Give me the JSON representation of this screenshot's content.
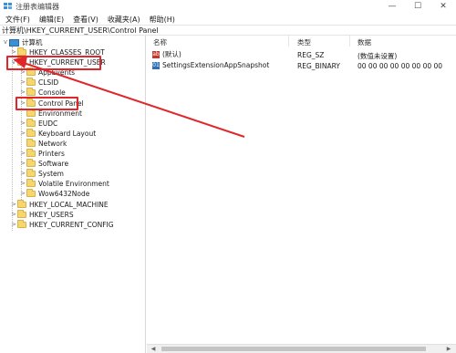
{
  "window": {
    "title": "注册表编辑器",
    "minimize": "—",
    "maximize": "☐",
    "close": "✕"
  },
  "menu": [
    "文件(F)",
    "编辑(E)",
    "查看(V)",
    "收藏夹(A)",
    "帮助(H)"
  ],
  "address": "计算机\\HKEY_CURRENT_USER\\Control Panel",
  "tree": {
    "root": "计算机",
    "items": [
      {
        "label": "HKEY_CLASSES_ROOT",
        "expander": ">"
      },
      {
        "label": "HKEY_CURRENT_USER",
        "expander": "v"
      },
      {
        "label": "AppEvents",
        "expander": ">"
      },
      {
        "label": "CLSID",
        "expander": ">"
      },
      {
        "label": "Console",
        "expander": ">"
      },
      {
        "label": "Control Panel",
        "expander": ">"
      },
      {
        "label": "Environment",
        "expander": ""
      },
      {
        "label": "EUDC",
        "expander": ">"
      },
      {
        "label": "Keyboard Layout",
        "expander": ">"
      },
      {
        "label": "Network",
        "expander": ""
      },
      {
        "label": "Printers",
        "expander": ">"
      },
      {
        "label": "Software",
        "expander": ">"
      },
      {
        "label": "System",
        "expander": ">"
      },
      {
        "label": "Volatile Environment",
        "expander": ">"
      },
      {
        "label": "Wow6432Node",
        "expander": ">"
      },
      {
        "label": "HKEY_LOCAL_MACHINE",
        "expander": ">"
      },
      {
        "label": "HKEY_USERS",
        "expander": ">"
      },
      {
        "label": "HKEY_CURRENT_CONFIG",
        "expander": ">"
      }
    ]
  },
  "list": {
    "headers": {
      "name": "名称",
      "type": "类型",
      "data": "数据"
    },
    "rows": [
      {
        "name": "(默认)",
        "type": "REG_SZ",
        "data": "(数值未设置)",
        "icon": "ab"
      },
      {
        "name": "SettingsExtensionAppSnapshot",
        "type": "REG_BINARY",
        "data": "00 00 00 00 00 00 00 00",
        "icon": "01"
      }
    ]
  },
  "colors": {
    "highlight": "#e0262a",
    "folder": "#f7d66e"
  }
}
